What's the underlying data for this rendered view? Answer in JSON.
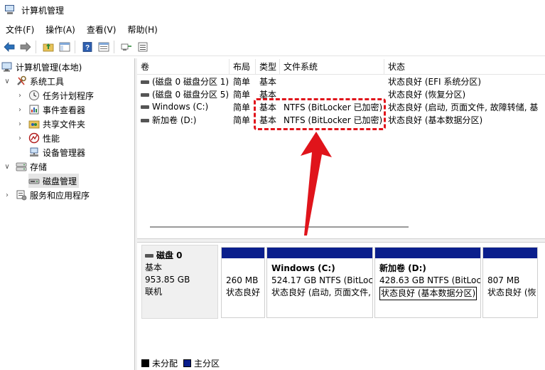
{
  "window": {
    "title": "计算机管理"
  },
  "menu": {
    "file": "文件(F)",
    "action": "操作(A)",
    "view": "查看(V)",
    "help": "帮助(H)"
  },
  "toolbar": {
    "icons": [
      "back-arrow-icon",
      "forward-arrow-icon",
      "up-folder-icon",
      "show-hide-tree-icon",
      "help-icon",
      "properties-icon",
      "connect-icon",
      "export-list-icon"
    ]
  },
  "tree": {
    "root": "计算机管理(本地)",
    "system_tools": "系统工具",
    "task_scheduler": "任务计划程序",
    "event_viewer": "事件查看器",
    "shared_folders": "共享文件夹",
    "performance": "性能",
    "device_manager": "设备管理器",
    "storage": "存储",
    "disk_management": "磁盘管理",
    "services_apps": "服务和应用程序"
  },
  "columns": {
    "volume": "卷",
    "layout": "布局",
    "type": "类型",
    "filesystem": "文件系统",
    "status": "状态"
  },
  "volumes": [
    {
      "name": "(磁盘 0 磁盘分区 1)",
      "layout": "简单",
      "type": "基本",
      "fs": "",
      "status": "状态良好 (EFI 系统分区)"
    },
    {
      "name": "(磁盘 0 磁盘分区 5)",
      "layout": "简单",
      "type": "基本",
      "fs": "",
      "status": "状态良好 (恢复分区)"
    },
    {
      "name": "Windows (C:)",
      "layout": "简单",
      "type": "基本",
      "fs": "NTFS (BitLocker 已加密)",
      "status": "状态良好 (启动, 页面文件, 故障转储, 基"
    },
    {
      "name": "新加卷 (D:)",
      "layout": "简单",
      "type": "基本",
      "fs": "NTFS (BitLocker 已加密)",
      "status": "状态良好 (基本数据分区)"
    }
  ],
  "disk": {
    "name": "磁盘 0",
    "type": "基本",
    "size": "953.85 GB",
    "state": "联机"
  },
  "partitions": [
    {
      "title": "",
      "size": "260 MB",
      "status": "状态良好"
    },
    {
      "title": "Windows  (C:)",
      "size": "524.17 GB NTFS (BitLoc",
      "status": "状态良好 (启动, 页面文件,"
    },
    {
      "title": "新加卷  (D:)",
      "size": "428.63 GB NTFS (BitLoc",
      "status": "状态良好 (基本数据分区)"
    },
    {
      "title": "",
      "size": "807 MB",
      "status": "状态良好 (恢"
    }
  ],
  "legend": {
    "unallocated": "未分配",
    "primary": "主分区"
  },
  "colors": {
    "primary_partition": "#0a1e8c",
    "unallocated": "#000000",
    "annotation": "#e0141b",
    "selection": "#e5e5e5"
  }
}
